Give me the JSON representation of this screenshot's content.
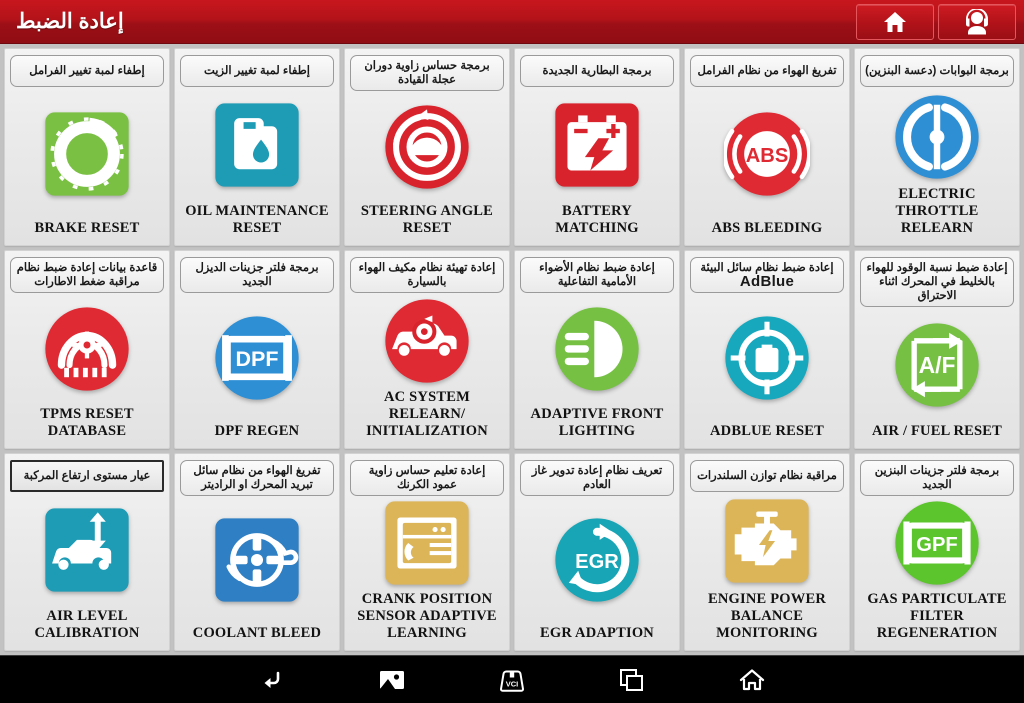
{
  "header": {
    "title": "إعادة الضبط",
    "buttons": [
      {
        "name": "home-button",
        "icon": "home-icon"
      },
      {
        "name": "support-button",
        "icon": "headset-user-icon"
      }
    ]
  },
  "grid": {
    "columns": 6,
    "rows": 3,
    "cards": [
      {
        "arabic": "إطفاء لمبة تغيير الفرامل",
        "english": "BRAKE RESET",
        "icon": "brake-disc-icon",
        "shape": "square",
        "color": "#7ac043",
        "selected": false
      },
      {
        "arabic": "إطفاء لمبة تغيير الزيت",
        "english": "OIL MAINTENANCE RESET",
        "icon": "oil-can-icon",
        "shape": "square",
        "color": "#1e9bb5",
        "selected": false
      },
      {
        "arabic": "برمجة حساس زاوية دوران عجلة القيادة",
        "english": "STEERING ANGLE RESET",
        "icon": "steering-wheel-icon",
        "shape": "circle",
        "color": "#d9232c",
        "selected": false
      },
      {
        "arabic": "برمجة البطارية الجديدة",
        "english": "BATTERY MATCHING",
        "icon": "battery-icon",
        "shape": "square",
        "color": "#d9232c",
        "selected": false
      },
      {
        "arabic": "تفريغ الهواء من نظام الفرامل",
        "english": "ABS BLEEDING",
        "icon": "abs-icon",
        "shape": "circle",
        "color": "#e02a33",
        "selected": false
      },
      {
        "arabic": "برمجة البوابات (دعسة البنزين)",
        "english": "ELECTRIC THROTTLE RELEARN",
        "icon": "throttle-icon",
        "shape": "circle",
        "color": "#2e8fd4",
        "selected": false
      },
      {
        "arabic": "قاعدة بيانات إعادة ضبط نظام مراقبة ضغط الاطارات",
        "english": "TPMS RESET DATABASE",
        "icon": "tire-pressure-icon",
        "shape": "circle",
        "color": "#e02a33",
        "selected": false
      },
      {
        "arabic": "برمجة فلتر جزينات الديزل الجديد",
        "english": "DPF REGEN",
        "icon": "dpf-icon",
        "shape": "circle",
        "color": "#2e8fd4",
        "selected": false
      },
      {
        "arabic": "إعادة تهيئة نظام مكيف الهواء بالسيارة",
        "english": "AC SYSTEM RELEARN/ INITIALIZATION",
        "icon": "car-ac-icon",
        "shape": "circle",
        "color": "#e02a33",
        "selected": false
      },
      {
        "arabic": "إعادة ضبط نظام الأضواء الأمامية التفاعلية",
        "english": "ADAPTIVE FRONT LIGHTING",
        "icon": "headlight-icon",
        "shape": "circle",
        "color": "#76c043",
        "selected": false
      },
      {
        "arabic": "إعادة ضبط نظام سائل البيئة",
        "english": "ADBLUE RESET",
        "latin_extra": "AdBlue",
        "icon": "adblue-icon",
        "shape": "circle",
        "color": "#17a8bd",
        "selected": false
      },
      {
        "arabic": "إعادة ضبط نسبة الوقود للهواء بالخليط في المحرك اثناء الاحتراق",
        "english": "AIR / FUEL RESET",
        "icon": "air-fuel-icon",
        "shape": "circle",
        "color": "#76c043",
        "selected": false
      },
      {
        "arabic": "عيار مستوى ارتفاع المركبة",
        "english": "AIR LEVEL CALIBRATION",
        "icon": "car-height-icon",
        "shape": "square",
        "color": "#1e9bb5",
        "selected": true
      },
      {
        "arabic": "تفريغ الهواء من نظام سائل تبريد المحرك او الراديتر",
        "english": "COOLANT BLEED",
        "icon": "water-pump-icon",
        "shape": "square",
        "color": "#2e7fc4",
        "selected": false
      },
      {
        "arabic": "إعادة تعليم حساس زاوية عمود الكرنك",
        "english": "CRANK POSITION SENSOR ADAPTIVE LEARNING",
        "icon": "crank-sensor-icon",
        "shape": "square",
        "color": "#dcb558",
        "selected": false
      },
      {
        "arabic": "تعريف نظام إعادة تدوير غاز العادم",
        "english": "EGR ADAPTION",
        "icon": "egr-icon",
        "shape": "circle",
        "color": "#18a5b5",
        "selected": false
      },
      {
        "arabic": "مراقبة نظام توازن السلندرات",
        "english": "ENGINE POWER BALANCE MONITORING",
        "icon": "engine-power-icon",
        "shape": "square",
        "color": "#dcb558",
        "selected": false
      },
      {
        "arabic": "برمجة فلتر جزينات البنزين الجديد",
        "english": "GAS PARTICULATE FILTER REGENERATION",
        "icon": "gpf-icon",
        "shape": "circle",
        "color": "#5cc42c",
        "selected": false
      }
    ]
  },
  "navbar": {
    "buttons": [
      {
        "name": "back-button",
        "icon": "back-arrow-icon"
      },
      {
        "name": "screenshot-button",
        "icon": "image-icon"
      },
      {
        "name": "vci-button",
        "icon": "vci-connector-icon",
        "label": "VCI"
      },
      {
        "name": "recent-apps-button",
        "icon": "recent-apps-icon"
      },
      {
        "name": "home-button",
        "icon": "home-outline-icon"
      }
    ]
  },
  "colors": {
    "header_red": "#b3131a",
    "background_gray": "#c2c2c2",
    "card_bg": "#ecECec",
    "navbar_black": "#000000"
  }
}
